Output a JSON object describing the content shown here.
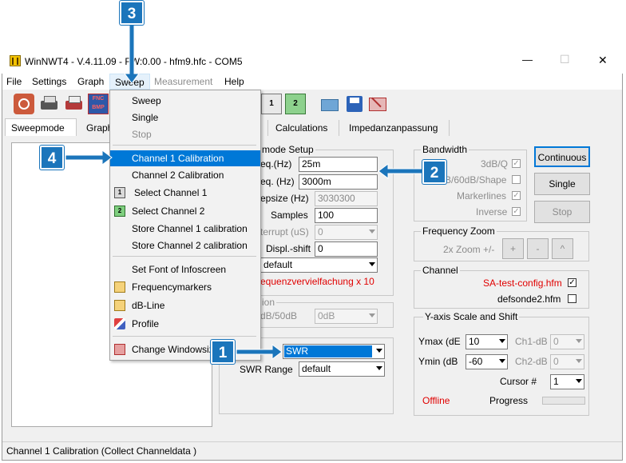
{
  "window": {
    "title": "WinNWT4 - V.4.11.09 - FW:0.00 - hfm9.hfc - COM5",
    "minimize": "—",
    "maximize": "☐",
    "close": "✕"
  },
  "menubar": [
    "File",
    "Settings",
    "Graph",
    "Sweep",
    "Measurement",
    "Help"
  ],
  "tabs": {
    "sweepmode": "Sweepmode",
    "graph": "Graph",
    "calculations": "Calculations",
    "impedance": "Impedanzanpassung"
  },
  "sweep_menu": {
    "items": [
      {
        "label": "Sweep",
        "icon": "",
        "enabled": true
      },
      {
        "label": "Single",
        "icon": "",
        "enabled": true
      },
      {
        "label": "Stop",
        "icon": "",
        "enabled": false
      },
      {
        "label": "Channel 1 Calibration",
        "icon": "",
        "enabled": true,
        "highlighted": true
      },
      {
        "label": "Channel 2 Calibration",
        "icon": "",
        "enabled": true
      },
      {
        "label": "Select Channel 1",
        "icon": "channel1-icon",
        "enabled": true
      },
      {
        "label": "Select Channel  2",
        "icon": "channel2-icon",
        "enabled": true
      },
      {
        "label": "Store  Channel  1 calibration",
        "icon": "",
        "enabled": true
      },
      {
        "label": "Store Channel  2  calibration",
        "icon": "",
        "enabled": true
      },
      {
        "label": "Set Font of Infoscreen",
        "icon": "",
        "enabled": true
      },
      {
        "label": "Frequencymarkers",
        "icon": "frequencymarkers-icon",
        "enabled": true
      },
      {
        "label": "dB-Line",
        "icon": "db-line-icon",
        "enabled": true
      },
      {
        "label": "Profile",
        "icon": "profile-icon",
        "enabled": true
      },
      {
        "label": "Change Windowsiz",
        "icon": "change-window-icon",
        "enabled": true
      }
    ]
  },
  "sweepmode_setup": {
    "title": "mode Setup",
    "start_label": "eq.(Hz)",
    "start_value": "25m",
    "stop_label": "eq. (Hz)",
    "stop_value": "3000m",
    "stepsize_label": "epsize (Hz)",
    "stepsize_value": "3030300",
    "samples_label": "Samples",
    "samples_value": "100",
    "interrupt_label": "terrupt (uS)",
    "interrupt_value": "0",
    "displshift_label": "Displ.-shift",
    "displshift_value": "0",
    "mult_value": "default",
    "mult_note": "equenzvervielfachung x 10"
  },
  "attenuation": {
    "title": "ion",
    "label": "dB/50dB",
    "value": "0dB"
  },
  "swr": {
    "mode_value": "SWR",
    "range_label": "SWR Range",
    "range_value": "default"
  },
  "bandwidth": {
    "title": "Bandwidth",
    "q3db": "3dB/Q",
    "shape": "B/60dB/Shape",
    "markerlines": "Markerlines",
    "inverse": "Inverse"
  },
  "buttons": {
    "continuous": "Continuous",
    "single": "Single",
    "stop": "Stop"
  },
  "freq_zoom": {
    "title": "Frequency Zoom",
    "label": "2x Zoom +/-",
    "plus": "+",
    "minus": "-",
    "caret": "^"
  },
  "channel": {
    "title": "Channel",
    "ch1": "SA-test-config.hfm",
    "ch2": "defsonde2.hfm"
  },
  "yaxis": {
    "title": "Y-axis Scale and Shift",
    "ymax_label": "Ymax (dE",
    "ymax_value": "10",
    "ymin_label": "Ymin (dB",
    "ymin_value": "-60",
    "ch1db_label": "Ch1-dB",
    "ch1db_value": "0",
    "ch2db_label": "Ch2-dB",
    "ch2db_value": "0",
    "cursor_label": "Cursor #",
    "cursor_value": "1",
    "offline": "Offline",
    "progress": "Progress"
  },
  "status": "Channel 1 Calibration (Collect Channeldata )",
  "callouts": [
    "1",
    "2",
    "3",
    "4"
  ],
  "colors": {
    "highlight": "#0078d7",
    "callout": "#1b75bb",
    "red_text": "#e00000"
  }
}
